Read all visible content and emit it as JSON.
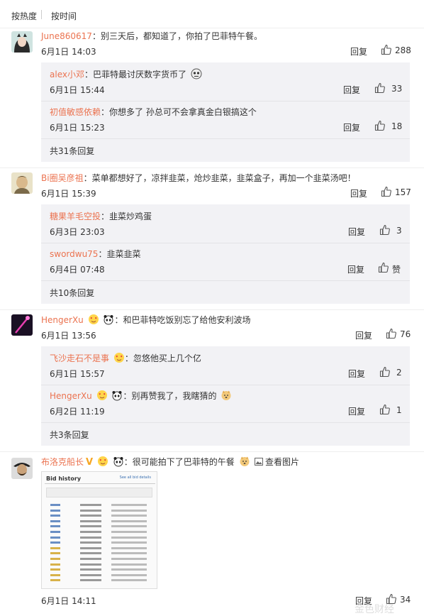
{
  "sort": {
    "hot_label": "按热度",
    "time_label": "按时间"
  },
  "comments": [
    {
      "user": "June860617",
      "sep": "：",
      "text": "别三天后，都知道了，你拍了巴菲特午餐。",
      "time": "6月1日 14:03",
      "reply_label": "回复",
      "likes": "288",
      "replies": [
        {
          "user": "alex小邓",
          "sep": "：",
          "text": "巴菲特最讨厌数字货币了",
          "time": "6月1日 15:44",
          "reply_label": "回复",
          "likes": "33"
        },
        {
          "user": "初值敏感依赖",
          "sep": "：",
          "text": "你想多了 孙总可不会拿真金白银搞这个",
          "time": "6月1日 15:23",
          "reply_label": "回复",
          "likes": "18"
        }
      ],
      "more": "共31条回复"
    },
    {
      "user": "Bi圈吴彦祖",
      "sep": "：",
      "text": "菜单都想好了，凉拌韭菜，炝炒韭菜，韭菜盒子，再加一个韭菜汤吧！",
      "time": "6月1日 15:39",
      "reply_label": "回复",
      "likes": "157",
      "replies": [
        {
          "user": "糖果羊毛空投",
          "sep": "：",
          "text": "韭菜炒鸡蛋",
          "time": "6月3日 23:03",
          "reply_label": "回复",
          "likes": "3"
        },
        {
          "user": "swordwu75",
          "sep": "：",
          "text": "韭菜韭菜",
          "time": "6月4日 07:48",
          "reply_label": "回复",
          "likes": "赞"
        }
      ],
      "more": "共10条回复"
    },
    {
      "user": "HengerXu",
      "sep": "：",
      "text": "和巴菲特吃饭别忘了给他安利波场",
      "time": "6月1日 13:56",
      "reply_label": "回复",
      "likes": "76",
      "replies": [
        {
          "user": "飞沙走石不是事",
          "sep": "：",
          "text": "忽悠他买上几个亿",
          "time": "6月1日 15:57",
          "reply_label": "回复",
          "likes": "2"
        },
        {
          "user": "HengerXu",
          "sep": "：",
          "text": "别再赞我了，我瞎猜的",
          "time": "6月2日 11:19",
          "reply_label": "回复",
          "likes": "1"
        }
      ],
      "more": "共3条回复"
    },
    {
      "user": "布洛克船长",
      "sep": "：",
      "text": "很可能拍下了巴菲特的午餐",
      "view_pic": "查看图片",
      "thumb_title": "Bid history",
      "thumb_link": "See all bid details",
      "time": "6月1日 14:11",
      "reply_label": "回复",
      "likes": "34"
    }
  ],
  "watermark": "金色财经",
  "colors": {
    "username": "#eb7350",
    "sub_bg": "#f2f2f5"
  }
}
